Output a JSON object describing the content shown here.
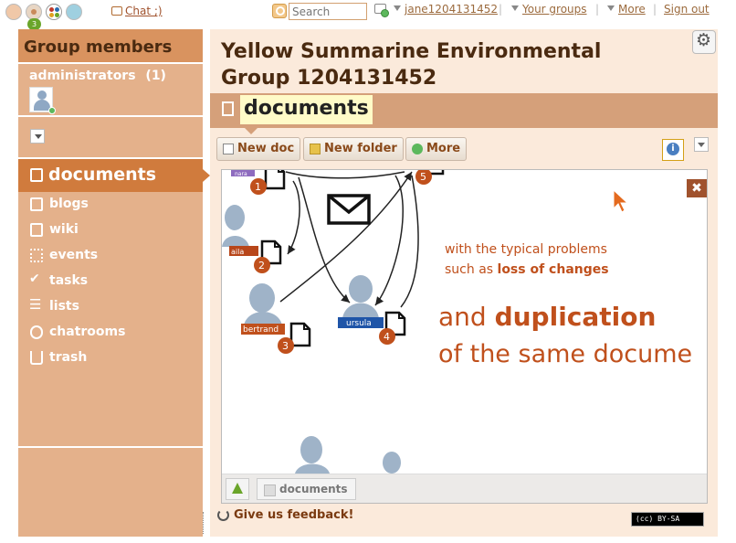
{
  "topbar": {
    "notification_count": "3",
    "chat_label": "Chat ;)",
    "search_placeholder": "Search",
    "username": "jane1204131452",
    "your_groups": "Your groups",
    "more": "More",
    "sign_out": "Sign out",
    "separator": "|"
  },
  "sidebar": {
    "header": "Group members",
    "admins_label": "administrators",
    "admins_count": "(1)",
    "nav": [
      {
        "label": "documents",
        "icon": "document-icon"
      },
      {
        "label": "blogs",
        "icon": "blog-icon"
      },
      {
        "label": "wiki",
        "icon": "wiki-icon"
      },
      {
        "label": "events",
        "icon": "calendar-icon"
      },
      {
        "label": "tasks",
        "icon": "check-icon"
      },
      {
        "label": "lists",
        "icon": "list-icon"
      },
      {
        "label": "chatrooms",
        "icon": "chat-icon"
      },
      {
        "label": "trash",
        "icon": "trash-icon"
      }
    ]
  },
  "main": {
    "group_title": "Yellow Summarine Environmental Group 1204131452",
    "section_title": "documents",
    "toolbar": {
      "new_doc": "New doc",
      "new_folder": "New folder",
      "more": "More"
    },
    "preview": {
      "persons": [
        {
          "name": "nara",
          "color": "#8e6bbf",
          "step": "1"
        },
        {
          "name": "aila",
          "color": "#b8461a",
          "step": "2"
        },
        {
          "name": "bertrand",
          "color": "#c0501c",
          "step": "3"
        },
        {
          "name": "ursula",
          "color": "#1f55a8",
          "step": "4"
        },
        {
          "name": "",
          "color": "#c0501c",
          "step": "5"
        }
      ],
      "caption_line1": "with the typical problems",
      "caption_line2_prefix": "such as ",
      "caption_line2_bold": "loss of changes",
      "headline_prefix": "and ",
      "headline_bold": "duplication",
      "headline_line2": "of the same docume",
      "close_label": "✖"
    },
    "footer_crumb": "documents",
    "feedback": "Give us feedback!",
    "license": "(cc) BY-SA"
  },
  "colors": {
    "accent": "#d07b3d",
    "sidebar_bg": "#e4b18b",
    "main_bg": "#fbeadb",
    "highlight": "#fffbc8"
  }
}
